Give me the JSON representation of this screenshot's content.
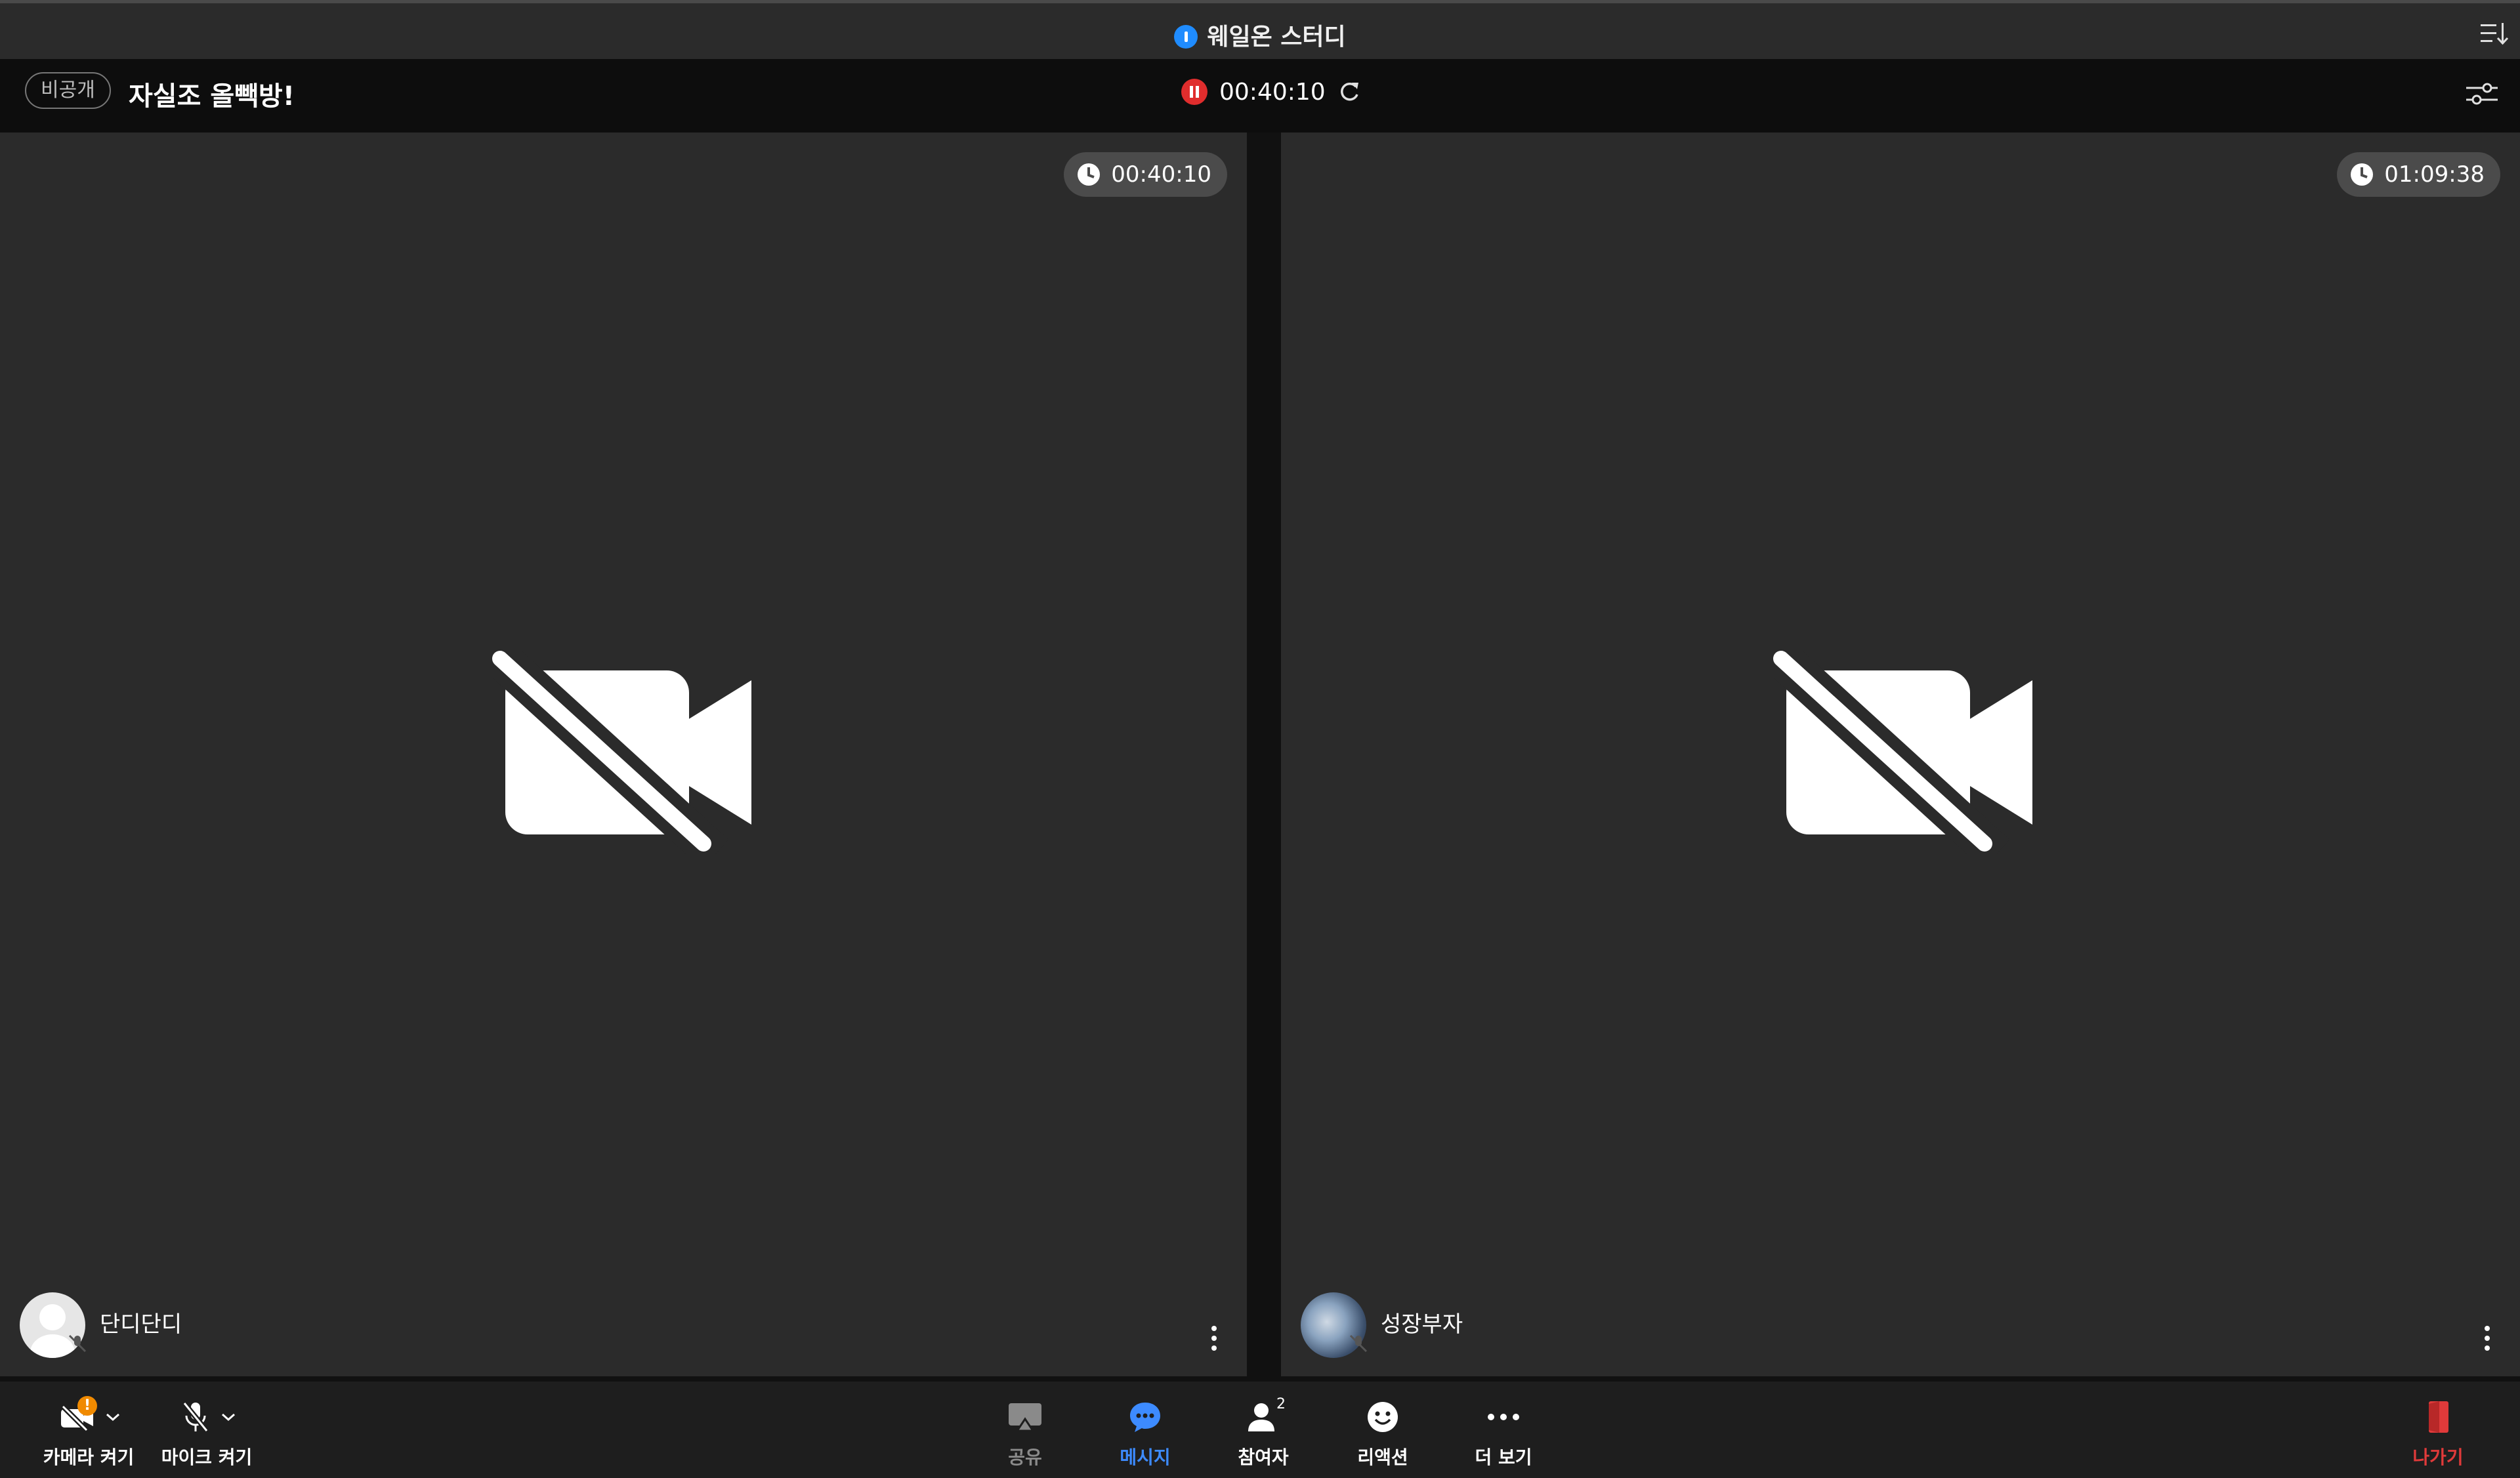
{
  "window": {
    "title": "웨일온 스터디"
  },
  "header": {
    "privacy_badge": "비공개",
    "room_name": "자실조 올빽방!",
    "recording_time": "00:40:10"
  },
  "participants": [
    {
      "name": "단디단디",
      "timer": "00:40:10",
      "camera": "off",
      "mic": "muted"
    },
    {
      "name": "성장부자",
      "timer": "01:09:38",
      "camera": "off",
      "mic": "muted"
    }
  ],
  "toolbar": {
    "camera_label": "카메라 켜기",
    "camera_warning": "!",
    "mic_label": "마이크 켜기",
    "share_label": "공유",
    "message_label": "메시지",
    "participants_label": "참여자",
    "participants_count": "2",
    "reaction_label": "리액션",
    "more_label": "더 보기",
    "leave_label": "나가기"
  },
  "colors": {
    "accent": "#3d8bff",
    "record": "#e02d2d",
    "leave": "#e03a3a",
    "warning": "#f08a00",
    "tile_bg": "#2b2b2b"
  }
}
